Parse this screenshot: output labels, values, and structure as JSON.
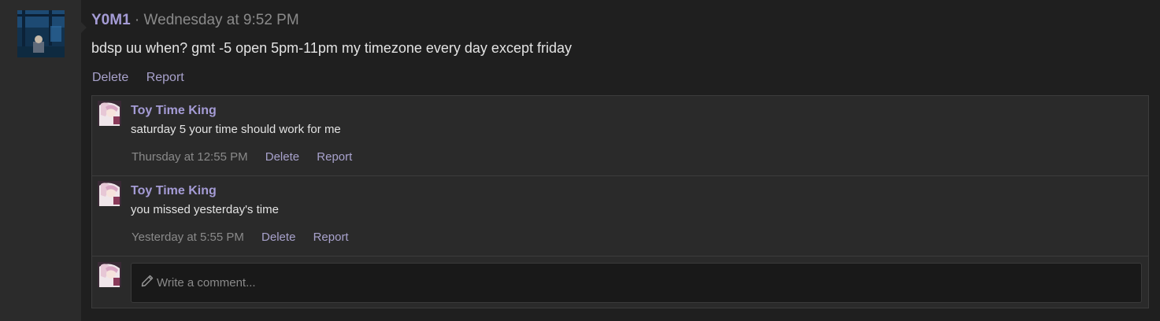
{
  "post": {
    "username": "Y0M1",
    "separator": " · ",
    "timestamp": "Wednesday at 9:52 PM",
    "text": "bdsp uu when? gmt -5 open 5pm-11pm my timezone every day except friday",
    "actions": {
      "delete": "Delete",
      "report": "Report"
    }
  },
  "replies": [
    {
      "username": "Toy Time King",
      "text": "saturday 5 your time should work for me",
      "timestamp": "Thursday at 12:55 PM",
      "delete": "Delete",
      "report": "Report"
    },
    {
      "username": "Toy Time King",
      "text": "you missed yesterday's time",
      "timestamp": "Yesterday at 5:55 PM",
      "delete": "Delete",
      "report": "Report"
    }
  ],
  "comment": {
    "placeholder": "Write a comment...",
    "icon": "pencil-icon"
  },
  "colors": {
    "accent": "#a59cd6",
    "background": "#1f1f1f",
    "sidebar": "#2b2b2b"
  }
}
